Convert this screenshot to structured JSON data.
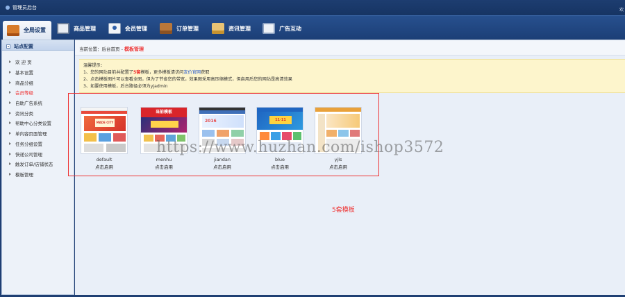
{
  "titlebar": {
    "title": "管理员后台",
    "welcome": "欢"
  },
  "nav": [
    {
      "label": "全局设置",
      "icon": "settings-icon",
      "active": true
    },
    {
      "label": "商品管理",
      "icon": "goods-icon"
    },
    {
      "label": "会员管理",
      "icon": "member-icon"
    },
    {
      "label": "订单管理",
      "icon": "order-icon"
    },
    {
      "label": "资讯管理",
      "icon": "news-icon"
    },
    {
      "label": "广告互动",
      "icon": "ad-icon"
    }
  ],
  "sidebar": {
    "header": "站点配置",
    "items": [
      {
        "label": "欢 迎 页"
      },
      {
        "label": "基本设置"
      },
      {
        "label": "商品分组"
      },
      {
        "label": "会员等级",
        "active": true
      },
      {
        "label": "自助广告系统"
      },
      {
        "label": "资讯分类"
      },
      {
        "label": "帮助中心分类设置"
      },
      {
        "label": "单内容页面管理"
      },
      {
        "label": "任务分组设置"
      },
      {
        "label": "快递公司管理"
      },
      {
        "label": "触发订单/店铺状态"
      },
      {
        "label": "模板管理"
      }
    ]
  },
  "breadcrumb": {
    "prefix": "当前位置：后台首页 - ",
    "current": "模板管理"
  },
  "tips": {
    "title": "温馨提示：",
    "line1_a": "1、您的网站目前共配置了",
    "line1_b": "5套",
    "line1_c": "模板，更多模板请访问",
    "line1_d": "友价官网",
    "line1_e": "获取",
    "line2": "2、点击模板图片可以查看全图，但为了节省您的带宽，效果图采用高压缩模式，但启用后您的网站是高清效果",
    "line3": "3、如要使用模板，后台路径必须为yjadmin"
  },
  "templates": [
    {
      "name": "default",
      "action": "点击启用",
      "theme_color": "#e8493a",
      "banner_text": "MADE CITY"
    },
    {
      "name": "menhu",
      "action": "点击启用",
      "theme_color": "#d9252a",
      "banner_text": "当前模板"
    },
    {
      "name": "jiandan",
      "action": "点击启用",
      "theme_color": "#3f6fb8",
      "banner_text": "2016"
    },
    {
      "name": "blue",
      "action": "点击启用",
      "theme_color": "#1f66c2",
      "banner_text": "11·11"
    },
    {
      "name": "yjls",
      "action": "点击启用",
      "theme_color": "#e9a13a",
      "banner_text": ""
    }
  ],
  "template_count_label": "5套模板",
  "watermark": "https://www.huzhan.com/ishop3572"
}
